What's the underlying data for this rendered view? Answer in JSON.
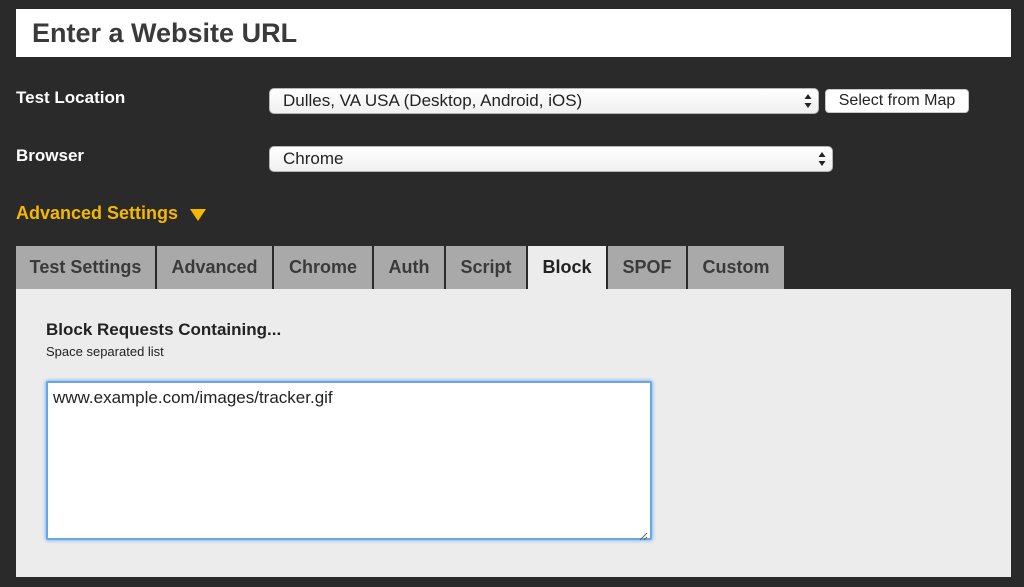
{
  "url_bar": {
    "text": "Enter a Website URL"
  },
  "test_location": {
    "label": "Test Location",
    "selected": "Dulles, VA USA (Desktop, Android, iOS)",
    "map_button": "Select from Map"
  },
  "browser": {
    "label": "Browser",
    "selected": "Chrome"
  },
  "advanced_settings": {
    "label": "Advanced Settings",
    "accent_color": "#f5b800"
  },
  "tabs": [
    {
      "label": "Test Settings",
      "active": false
    },
    {
      "label": "Advanced",
      "active": false
    },
    {
      "label": "Chrome",
      "active": false
    },
    {
      "label": "Auth",
      "active": false
    },
    {
      "label": "Script",
      "active": false
    },
    {
      "label": "Block",
      "active": true
    },
    {
      "label": "SPOF",
      "active": false
    },
    {
      "label": "Custom",
      "active": false
    }
  ],
  "block_panel": {
    "title": "Block Requests Containing...",
    "hint": "Space separated list",
    "value": "www.example.com/images/tracker.gif"
  }
}
